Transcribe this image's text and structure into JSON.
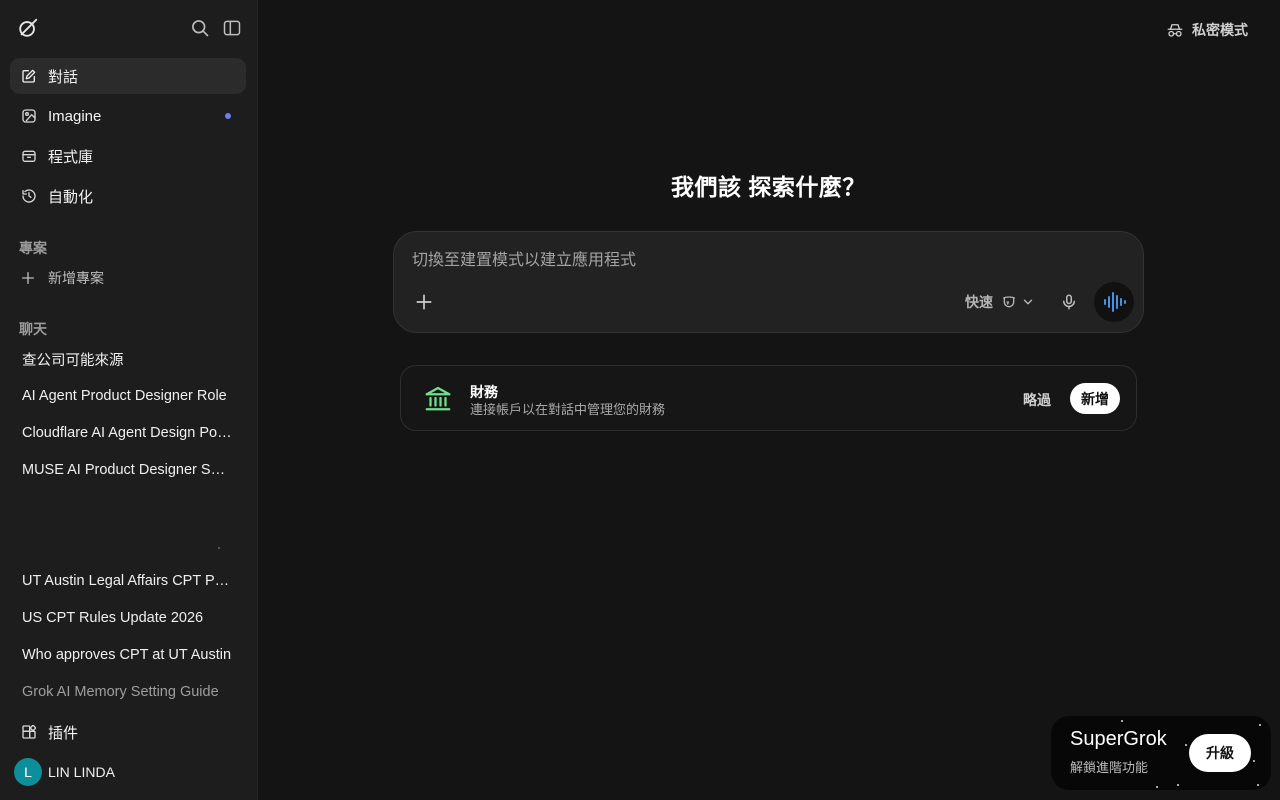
{
  "sidebar": {
    "nav": [
      {
        "label": "對話",
        "icon": "edit-icon",
        "active": true
      },
      {
        "label": "Imagine",
        "icon": "image-icon",
        "badge": true
      },
      {
        "label": "程式庫",
        "icon": "library-icon"
      },
      {
        "label": "自動化",
        "icon": "automation-icon"
      }
    ],
    "projects_title": "專案",
    "new_project_label": "新增專案",
    "chats_title": "聊天",
    "chats": [
      "查公司可能來源",
      "AI Agent Product Designer Role",
      "Cloudflare AI Agent Design Position",
      "MUSE AI Product Designer Salary",
      "UT Austin Legal Affairs CPT Process",
      "US CPT Rules Update 2026",
      "Who approves CPT at UT Austin",
      "Grok AI Memory Setting Guide"
    ],
    "plugins_label": "插件",
    "user": {
      "initial": "L",
      "name": "LIN LINDA"
    }
  },
  "header": {
    "private_label": "私密模式"
  },
  "main": {
    "headline": "我們該 探索什麼？",
    "composer": {
      "placeholder": "切換至建置模式以建立應用程式",
      "value": "",
      "mode_label": "快速"
    },
    "finance_card": {
      "title": "財務",
      "description": "連接帳戶以在對話中管理您的財務",
      "skip_label": "略過",
      "add_label": "新增"
    }
  },
  "promo": {
    "brand": "SuperGrok",
    "subtitle": "解鎖進階功能",
    "upgrade_label": "升級"
  },
  "colors": {
    "background": "#141414",
    "sidebar": "#1d1d1d",
    "accent_dot": "#6d7cf5",
    "voice_accent": "#4a90e2",
    "finance_icon": "#6fe08a",
    "avatar": "#0d8e9a"
  }
}
